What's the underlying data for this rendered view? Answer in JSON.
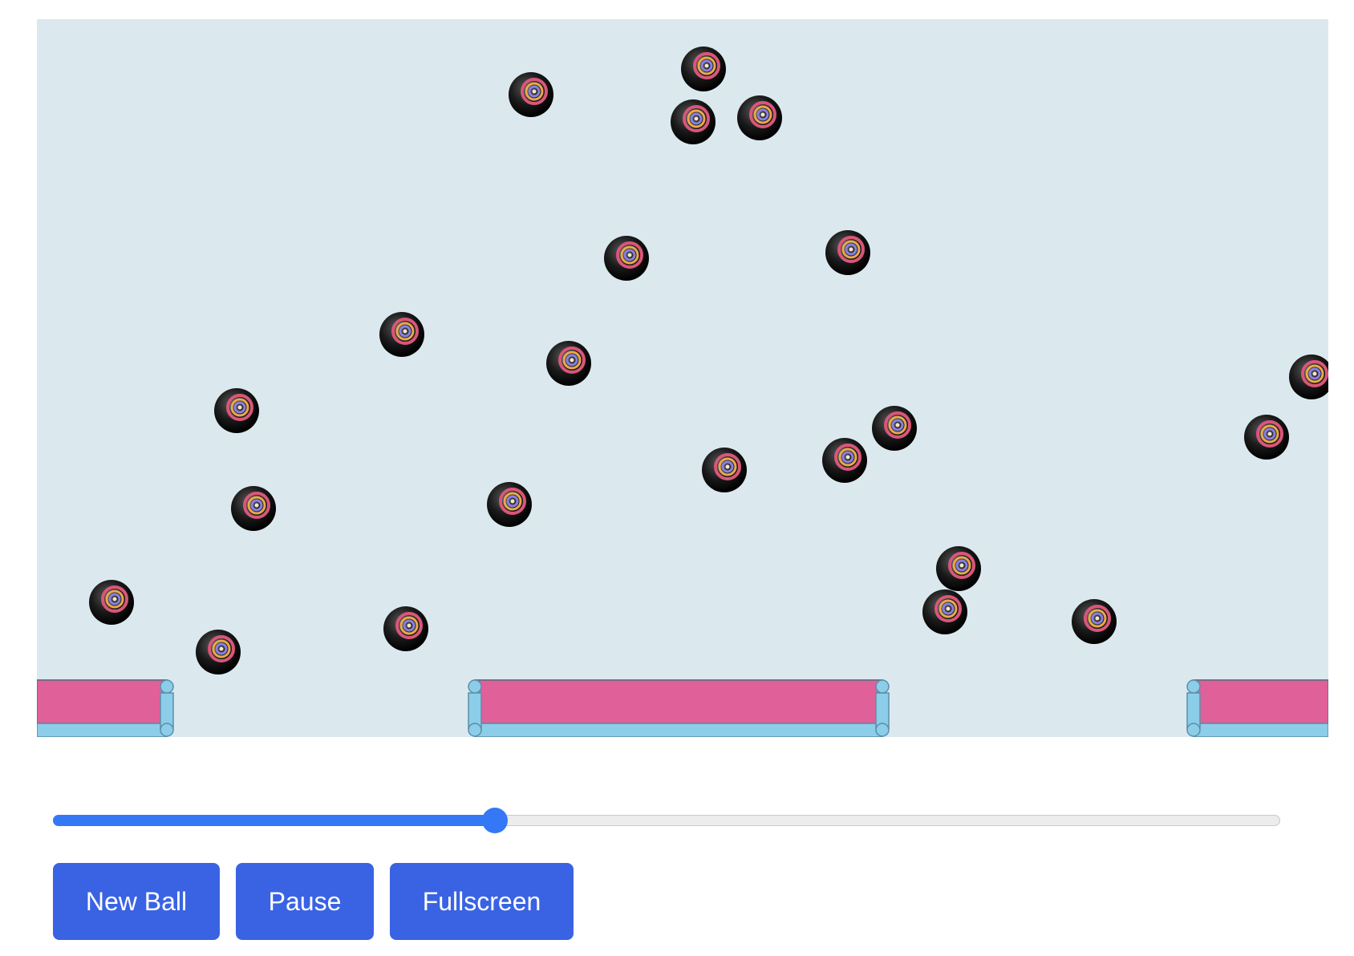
{
  "controls": {
    "slider_value": 0.36,
    "new_ball_label": "New Ball",
    "pause_label": "Pause",
    "fullscreen_label": "Fullscreen"
  },
  "scene": {
    "background_color": "#dbe9ef",
    "platform_color": "#e0609a",
    "rail_color": "#8ccde9",
    "ball_count": 24
  },
  "colors": {
    "accent": "#3478f6",
    "button": "#3a63e3"
  }
}
